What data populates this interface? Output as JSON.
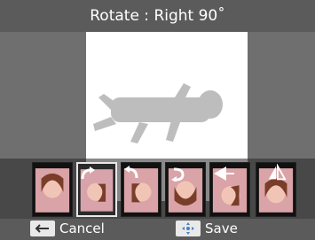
{
  "title": "Rotate : Right 90˚",
  "thumbnails": [
    {
      "name": "original",
      "icon": "none"
    },
    {
      "name": "rotate-right-90",
      "icon": "rotate-right-icon",
      "selected": true
    },
    {
      "name": "rotate-left-90",
      "icon": "rotate-left-icon"
    },
    {
      "name": "rotate-180",
      "icon": "rotate-180-icon"
    },
    {
      "name": "flip-horizontal",
      "icon": "flip-horizontal-icon"
    },
    {
      "name": "flip-vertical",
      "icon": "flip-vertical-icon"
    }
  ],
  "footer": {
    "cancel_label": "Cancel",
    "cancel_icon": "back-arrow-icon",
    "save_label": "Save",
    "save_icon": "dpad-icon"
  }
}
